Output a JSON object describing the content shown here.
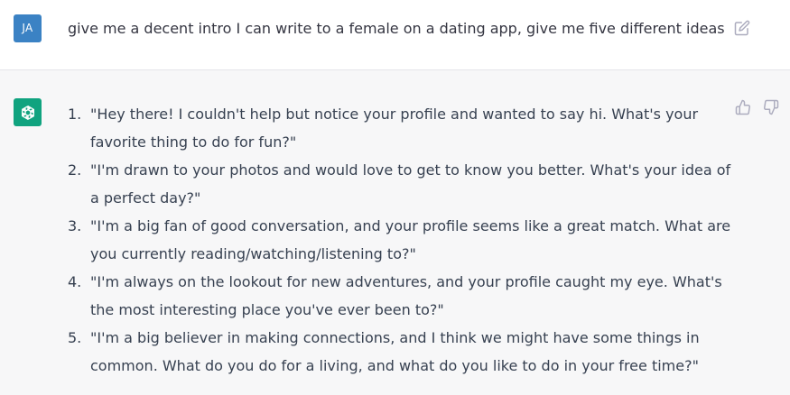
{
  "user": {
    "avatar_initials": "JA",
    "message": "give me a decent intro I can write to a female on a dating app, give me five different ideas"
  },
  "assistant": {
    "avatar_icon": "openai-logo-icon",
    "items": [
      {
        "number": "1.",
        "text": "\"Hey there! I couldn't help but notice your profile and wanted to say hi. What's your favorite thing to do for fun?\""
      },
      {
        "number": "2.",
        "text": "\"I'm drawn to your photos and would love to get to know you better. What's your idea of a perfect day?\""
      },
      {
        "number": "3.",
        "text": "\"I'm a big fan of good conversation, and your profile seems like a great match. What are you currently reading/watching/listening to?\""
      },
      {
        "number": "4.",
        "text": "\"I'm always on the lookout for new adventures, and your profile caught my eye. What's the most interesting place you've ever been to?\""
      },
      {
        "number": "5.",
        "text": "\"I'm a big believer in making connections, and I think we might have some things in common. What do you do for a living, and what do you like to do in your free time?\""
      }
    ]
  },
  "icons": {
    "edit": "edit-icon",
    "thumbs_up": "thumbs-up-icon",
    "thumbs_down": "thumbs-down-icon"
  },
  "colors": {
    "user_avatar": "#3b82c4",
    "assistant_avatar": "#10a37f",
    "assistant_bg": "#f7f7f8"
  }
}
